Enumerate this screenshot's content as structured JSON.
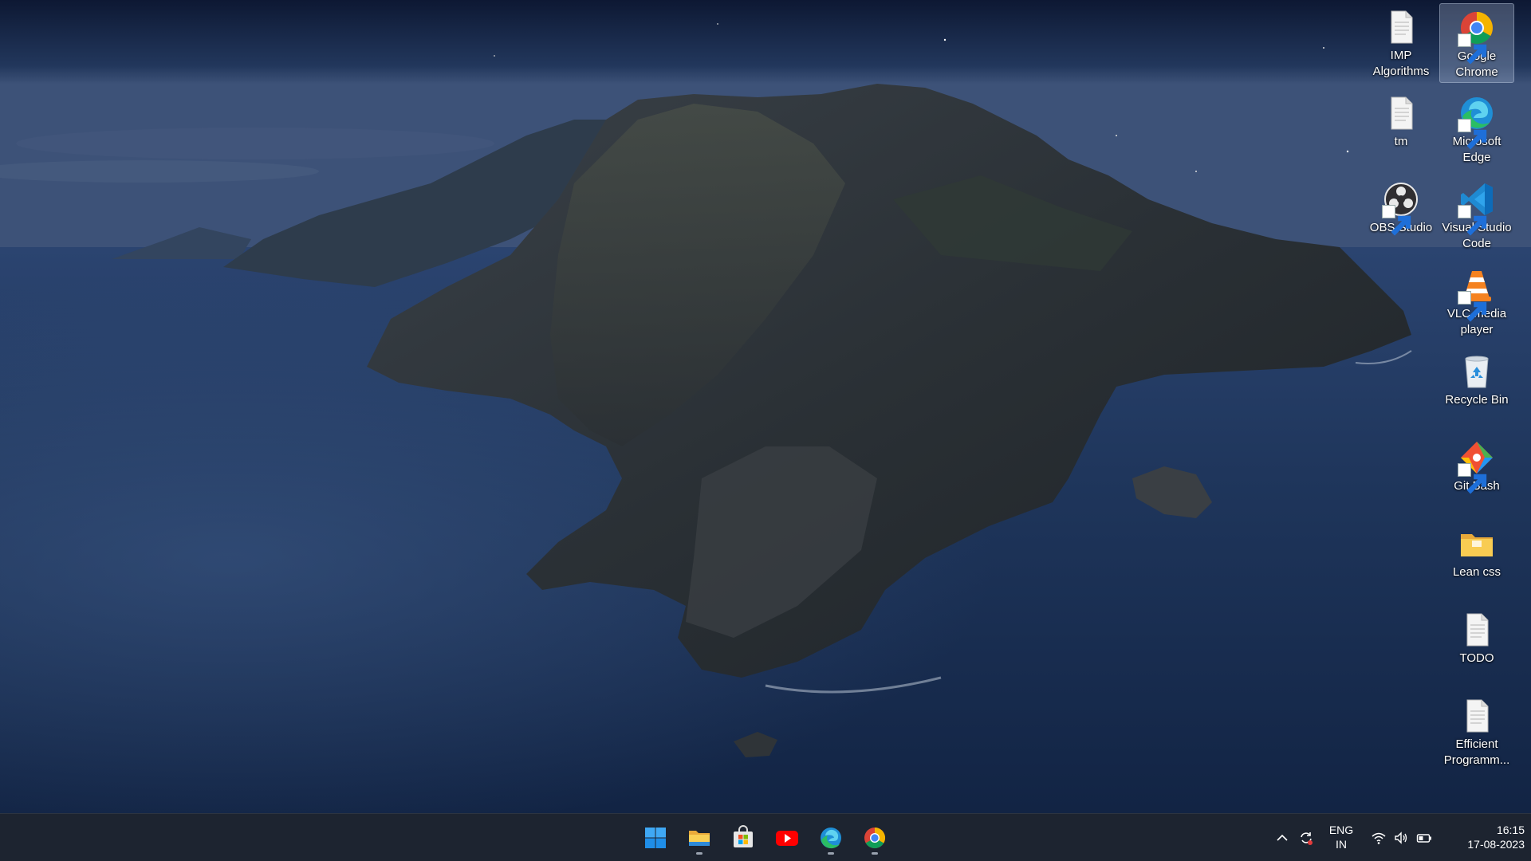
{
  "desktop": {
    "icons": [
      {
        "label": "IMP Algorithms",
        "icon": "text-file-icon",
        "shortcut": false
      },
      {
        "label": "Google Chrome",
        "icon": "chrome-icon",
        "shortcut": true,
        "selected": true
      },
      {
        "label": "tm",
        "icon": "text-file-icon",
        "shortcut": false
      },
      {
        "label": "Microsoft Edge",
        "icon": "edge-icon",
        "shortcut": true
      },
      {
        "label": "OBS Studio",
        "icon": "obs-icon",
        "shortcut": true
      },
      {
        "label": "Visual Studio Code",
        "icon": "vscode-icon",
        "shortcut": true
      },
      {
        "label": "VLC media player",
        "icon": "vlc-icon",
        "shortcut": true
      },
      {
        "label": "Recycle Bin",
        "icon": "recycle-bin-icon",
        "shortcut": false
      },
      {
        "label": "Git Bash",
        "icon": "git-bash-icon",
        "shortcut": true
      },
      {
        "label": "Lean css",
        "icon": "folder-icon",
        "shortcut": false
      },
      {
        "label": "TODO",
        "icon": "text-file-icon",
        "shortcut": false
      },
      {
        "label": "Efficient Programm...",
        "icon": "text-file-icon",
        "shortcut": false
      }
    ]
  },
  "taskbar": {
    "apps": [
      {
        "name": "start",
        "icon": "windows-start-icon",
        "running": false
      },
      {
        "name": "file-explorer",
        "icon": "file-explorer-icon",
        "running": true
      },
      {
        "name": "microsoft-store",
        "icon": "store-icon",
        "running": false
      },
      {
        "name": "youtube",
        "icon": "youtube-icon",
        "running": false
      },
      {
        "name": "edge",
        "icon": "edge-icon",
        "running": true
      },
      {
        "name": "chrome",
        "icon": "chrome-icon",
        "running": true
      }
    ],
    "tray": {
      "language_line1": "ENG",
      "language_line2": "IN",
      "time": "16:15",
      "date": "17-08-2023",
      "icons": [
        "chevron-up-icon",
        "sync-icon",
        "wifi-icon",
        "volume-icon",
        "battery-icon"
      ]
    }
  },
  "colors": {
    "taskbar_bg": "#1d2430",
    "sky_top": "#0e1a33",
    "sea": "#1d3358"
  }
}
